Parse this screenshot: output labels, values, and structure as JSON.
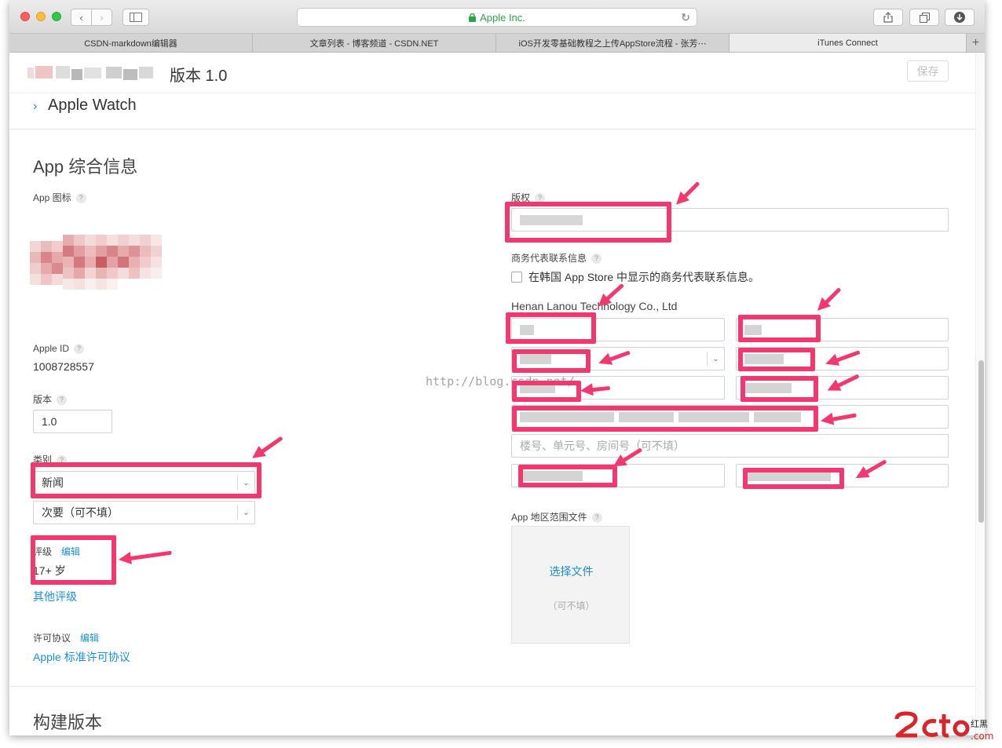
{
  "browser": {
    "url_text": "Apple Inc.",
    "tabs": [
      {
        "label": "CSDN-markdown编辑器"
      },
      {
        "label": "文章列表 - 博客频道 - CSDN.NET"
      },
      {
        "label": "iOS开发零基础教程之上传AppStore流程 - 张芳⋯"
      },
      {
        "label": "iTunes Connect"
      }
    ],
    "new_tab_icon": "plus-icon"
  },
  "header": {
    "version_title": "版本 1.0",
    "save_label": "保存",
    "apple_watch_label": "Apple Watch"
  },
  "app_info": {
    "section_title": "App 综合信息",
    "icon_label": "App 图标",
    "apple_id_label": "Apple ID",
    "apple_id_value": "1008728557",
    "version_label": "版本",
    "version_value": "1.0",
    "category_label": "类别",
    "primary_category": "新闻",
    "secondary_category": "次要（可不填）",
    "rating_label": "评级",
    "rating_edit": "编辑",
    "rating_value": "17+ 岁",
    "other_ratings": "其他评级",
    "license_label": "许可协议",
    "license_edit": "编辑",
    "license_value": "Apple 标准许可协议",
    "help_mark": "?"
  },
  "right_col": {
    "copyright_label": "版权",
    "rep_contact_label": "商务代表联系信息",
    "korea_checkbox_label": "在韩国 App Store 中显示的商务代表联系信息。",
    "company_name": "Henan Lanou Technology Co., Ltd",
    "address2_placeholder": "楼号、单元号、房间号（可不填）",
    "region_file_label": "App 地区范围文件",
    "choose_file": "选择文件",
    "optional": "（可不填）"
  },
  "build": {
    "section_title": "构建版本"
  },
  "watermark": "http://blog.csdn.net/",
  "colors": {
    "highlight": "#f2386e",
    "link": "#1a8fd8",
    "secure": "#2aa64a"
  }
}
